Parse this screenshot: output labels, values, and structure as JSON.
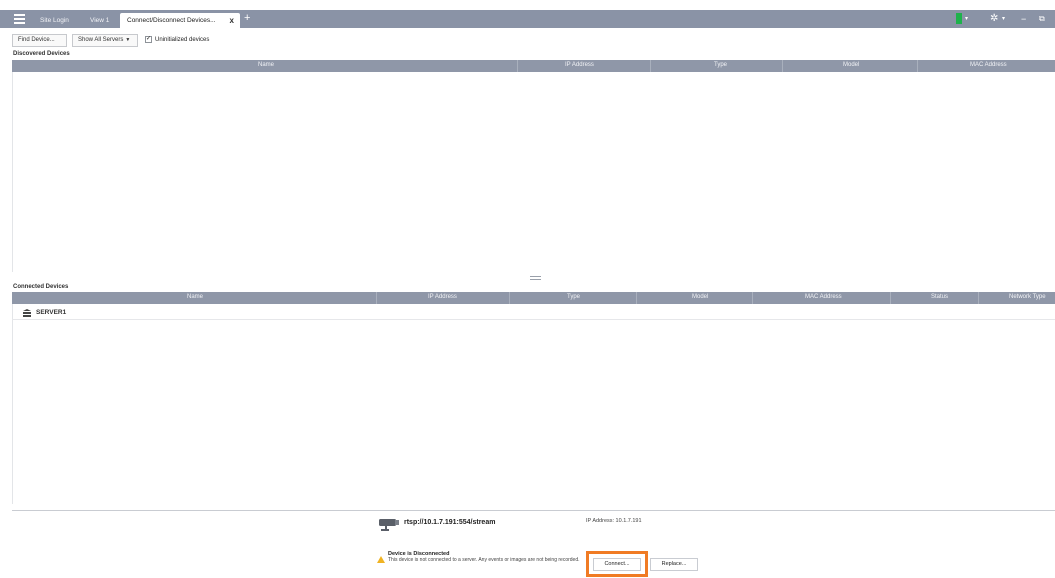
{
  "titlebar": {
    "tabs": [
      {
        "label": "Site Login"
      },
      {
        "label": "View 1"
      },
      {
        "label": "Connect/Disconnect Devices..."
      }
    ],
    "close_glyph": "x",
    "add_glyph": "+",
    "icons": {
      "menu": "hamburger-icon",
      "status": "green-status-indicator",
      "settings": "gear-icon",
      "minimize": "minimize-icon",
      "restore": "restore-icon"
    },
    "colors": {
      "bar": "#8a93a6",
      "status": "#1db24b"
    }
  },
  "toolbar": {
    "find_label": "Find Device...",
    "servers_label": "Show All Servers",
    "uninitialized_label": "Uninitialized devices",
    "uninitialized_checked": true
  },
  "discovered": {
    "title": "Discovered Devices",
    "columns": [
      "Name",
      "IP Address",
      "Type",
      "Model",
      "MAC Address"
    ],
    "rows": []
  },
  "connected": {
    "title": "Connected Devices",
    "columns": [
      "Name",
      "IP Address",
      "Type",
      "Model",
      "MAC Address",
      "Status",
      "Network Type"
    ],
    "rows": [
      {
        "name": "SERVER1"
      }
    ]
  },
  "details": {
    "url": "rtsp://10.1.7.191:554/stream",
    "ip_label": "IP Address: 10.1.7.191",
    "warning_title": "Device is Disconnected",
    "warning_text": "This device is not connected to a server. Any events or images are not being recorded.",
    "connect_label": "Connect...",
    "replace_label": "Replace...",
    "highlight_color": "#f07b24"
  }
}
